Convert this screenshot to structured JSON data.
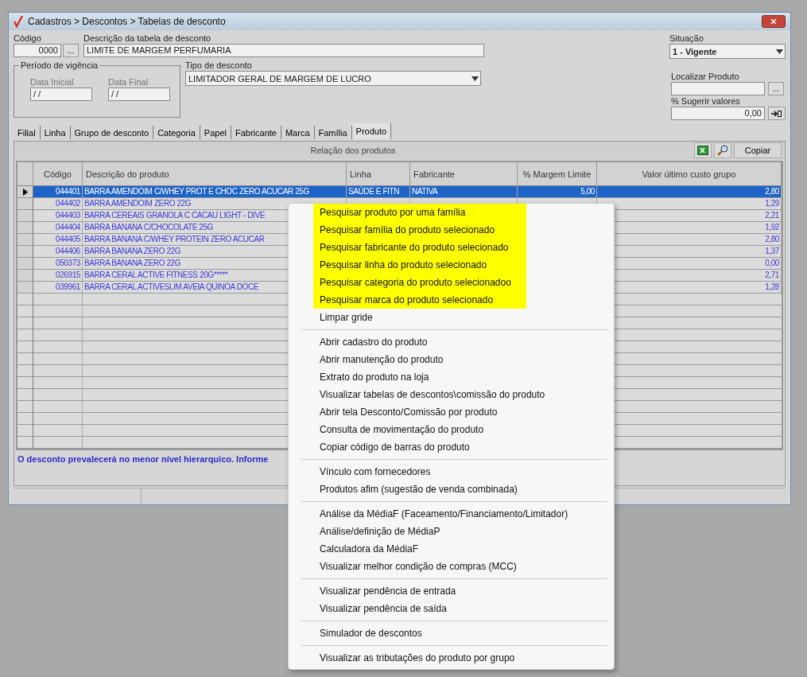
{
  "window": {
    "title": "Cadastros > Descontos > Tabelas de desconto"
  },
  "form": {
    "codigo_label": "Código",
    "codigo": "0000",
    "codigo_button": "...",
    "descricao_label": "Descrição da tabela de desconto",
    "descricao": "LIMITE DE MARGEM PERFUMARIA",
    "situacao_label": "Situação",
    "situacao": "1 - Vigente",
    "periodo_label": "Período de vigência",
    "data_inicial_label": "Data Inicial",
    "data_inicial": "/ /",
    "data_final_label": "Data Final",
    "data_final": "/ /",
    "tipo_label": "Tipo de desconto",
    "tipo": "LIMITADOR GERAL DE MARGEM DE LUCRO",
    "localizar_label": "Localizar Produto",
    "localizar_button": "...",
    "sugerir_label": "% Sugerir valores",
    "sugerir": "0,00"
  },
  "tabs": [
    {
      "label": "Filial",
      "selected": false
    },
    {
      "label": "Linha",
      "selected": false
    },
    {
      "label": "Grupo de desconto",
      "selected": false
    },
    {
      "label": "Categoria",
      "selected": false
    },
    {
      "label": "Papel",
      "selected": false
    },
    {
      "label": "Fabricante",
      "selected": false
    },
    {
      "label": "Marca",
      "selected": false
    },
    {
      "label": "Família",
      "selected": false
    },
    {
      "label": "Produto",
      "selected": true
    }
  ],
  "panel": {
    "title": "Relação dos produtos",
    "copy_button": "Copiar"
  },
  "table": {
    "columns": [
      "Código",
      "Descrição do produto",
      "Linha",
      "Fabricante",
      "% Margem Limite",
      "Valor último custo grupo"
    ],
    "rows": [
      {
        "selected": true,
        "cells": [
          "044401",
          "BARRA AMENDOIM C/WHEY PROT E CHOC ZERO ACUCAR 25G",
          "SAÚDE E FITN",
          "NATIVA",
          "5,00",
          "2,80"
        ]
      },
      {
        "selected": false,
        "cells": [
          "044402",
          "BARRA AMENDOIM ZERO 22G",
          "",
          "",
          "",
          "1,29"
        ]
      },
      {
        "selected": false,
        "cells": [
          "044403",
          "BARRA CEREAIS GRANOLA C CACAU LIGHT - DIVE",
          "",
          "",
          "",
          "2,21"
        ]
      },
      {
        "selected": false,
        "cells": [
          "044404",
          "BARRA BANANA C/CHOCOLATE 25G",
          "",
          "",
          "",
          "1,92"
        ]
      },
      {
        "selected": false,
        "cells": [
          "044405",
          "BARRA BANANA C/WHEY PROTEIN ZERO ACUCAR",
          "",
          "",
          "",
          "2,80"
        ]
      },
      {
        "selected": false,
        "cells": [
          "044406",
          "BARRA BANANA ZERO 22G",
          "",
          "",
          "",
          "1,37"
        ]
      },
      {
        "selected": false,
        "cells": [
          "050373",
          "BARRA BANANA ZERO 22G",
          "",
          "",
          "",
          "0,00"
        ]
      },
      {
        "selected": false,
        "cells": [
          "026915",
          "BARRA CERAL ACTIVE FITNESS 20G*****",
          "",
          "",
          "",
          "2,71"
        ]
      },
      {
        "selected": false,
        "cells": [
          "039961",
          "BARRA CERAL ACTIVESLIM AVEIA QUINOA DOCE",
          "",
          "",
          "",
          "1,28"
        ]
      }
    ]
  },
  "hint": "O desconto prevalecerá no menor nível hierarquico. Informe",
  "context_menu": [
    [
      {
        "label": "Pesquisar produto por uma família",
        "highlighted": true
      },
      {
        "label": "Pesquisar família do produto selecionado",
        "highlighted": true
      },
      {
        "label": "Pesquisar fabricante do produto selecionado",
        "highlighted": true
      },
      {
        "label": "Pesquisar linha do produto selecionado",
        "highlighted": true
      },
      {
        "label": "Pesquisar categoria do produto selecionadoo",
        "highlighted": true
      },
      {
        "label": "Pesquisar marca do produto selecionado",
        "highlighted": true
      },
      {
        "label": "Limpar gride",
        "highlighted": false
      }
    ],
    [
      {
        "label": "Abrir cadastro do produto",
        "highlighted": false
      },
      {
        "label": "Abrir manutenção do produto",
        "highlighted": false
      },
      {
        "label": "Extrato do produto na loja",
        "highlighted": false
      },
      {
        "label": "Visualizar tabelas de descontos\\comissão do produto",
        "highlighted": false
      },
      {
        "label": "Abrir tela Desconto/Comissão por produto",
        "highlighted": false
      },
      {
        "label": "Consulta de movimentação do produto",
        "highlighted": false
      },
      {
        "label": "Copiar código de barras do produto",
        "highlighted": false
      }
    ],
    [
      {
        "label": "Vínculo com fornecedores",
        "highlighted": false
      },
      {
        "label": "Produtos afim (sugestão de venda combinada)",
        "highlighted": false
      }
    ],
    [
      {
        "label": "Análise da MédiaF (Faceamento/Financiamento/Limitador)",
        "highlighted": false
      },
      {
        "label": "Análise/definição de MédiaP",
        "highlighted": false
      },
      {
        "label": "Calculadora da MédiaF",
        "highlighted": false
      },
      {
        "label": "Visualizar melhor condição de compras (MCC)",
        "highlighted": false
      }
    ],
    [
      {
        "label": "Visualizar pendência de entrada",
        "highlighted": false
      },
      {
        "label": "Visualizar pendência de saída",
        "highlighted": false
      }
    ],
    [
      {
        "label": "Simulador de descontos",
        "highlighted": false
      }
    ],
    [
      {
        "label": "Visualizar as tributações do produto por grupo",
        "highlighted": false
      }
    ]
  ]
}
